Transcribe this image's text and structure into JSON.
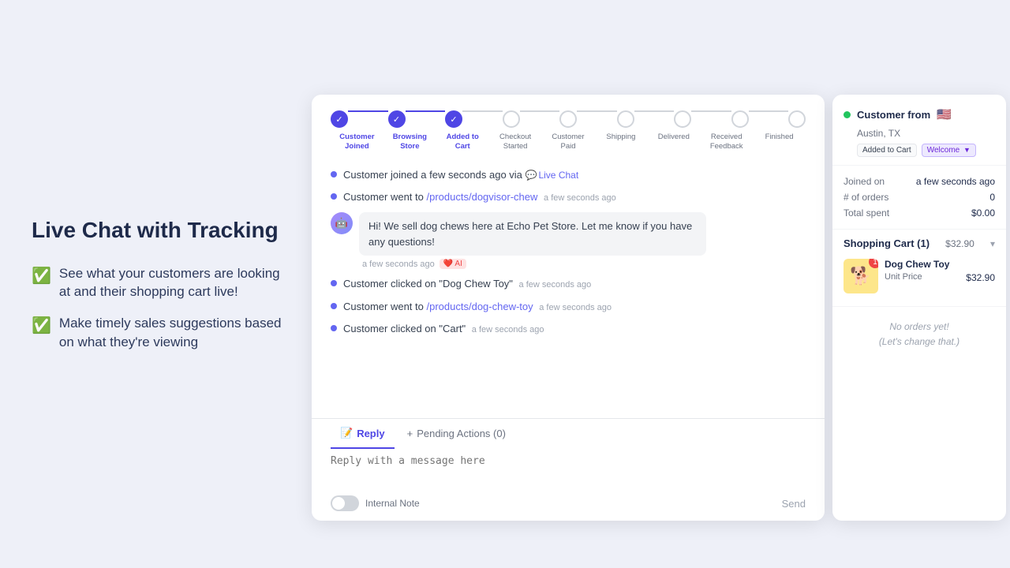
{
  "left": {
    "title": "Live Chat with Tracking",
    "features": [
      "See what your customers are looking at and their shopping cart live!",
      "Make timely sales suggestions based on what they're viewing"
    ]
  },
  "progress": {
    "steps": [
      {
        "label": "Customer\nJoined",
        "state": "completed"
      },
      {
        "label": "Browsing\nStore",
        "state": "completed"
      },
      {
        "label": "Added to\nCart",
        "state": "completed"
      },
      {
        "label": "Checkout\nStarted",
        "state": "inactive"
      },
      {
        "label": "Customer\nPaid",
        "state": "inactive"
      },
      {
        "label": "Shipping",
        "state": "inactive"
      },
      {
        "label": "Delivered",
        "state": "inactive"
      },
      {
        "label": "Received\nFeedback",
        "state": "inactive"
      },
      {
        "label": "Finished",
        "state": "inactive"
      }
    ]
  },
  "chat": {
    "events": [
      {
        "type": "event",
        "text": "Customer joined a few seconds ago via",
        "link": null,
        "channel": "Live Chat",
        "time": ""
      },
      {
        "type": "event",
        "text": "Customer went to",
        "link": "/products/dogvisor-chew",
        "suffix": "",
        "time": "a few seconds ago"
      },
      {
        "type": "ai-message",
        "text": "Hi! We sell dog chews here at Echo Pet Store. Let me know if you have any questions!",
        "time": "a few seconds ago",
        "badge": "❤️ AI"
      },
      {
        "type": "event",
        "text": "Customer clicked on \"Dog Chew Toy\"",
        "link": null,
        "time": "a few seconds ago"
      },
      {
        "type": "event",
        "text": "Customer went to",
        "link": "/products/dog-chew-toy",
        "suffix": "",
        "time": "a few seconds ago"
      },
      {
        "type": "event",
        "text": "Customer clicked on \"Cart\"",
        "link": null,
        "time": "a few seconds ago"
      }
    ],
    "tabs": {
      "reply_label": "Reply",
      "pending_label": "Pending Actions (0)"
    },
    "reply_placeholder": "Reply with a message here",
    "internal_note_label": "Internal Note",
    "send_label": "Send"
  },
  "right": {
    "customer_name": "Customer from",
    "flag": "🇺🇸",
    "location": "Austin, TX",
    "badge1": "Added to Cart",
    "badge2": "Welcome",
    "stats": {
      "joined_label": "Joined on",
      "joined_val": "a few seconds ago",
      "orders_label": "# of orders",
      "orders_val": "0",
      "spent_label": "Total spent",
      "spent_val": "$0.00"
    },
    "cart": {
      "title": "Shopping Cart (1)",
      "total": "$32.90",
      "item_name": "Dog Chew Toy",
      "unit_price_label": "Unit Price",
      "unit_price_val": "$32.90",
      "qty": "1"
    },
    "orders_empty": "No orders yet!\n(Let's change that.)"
  }
}
